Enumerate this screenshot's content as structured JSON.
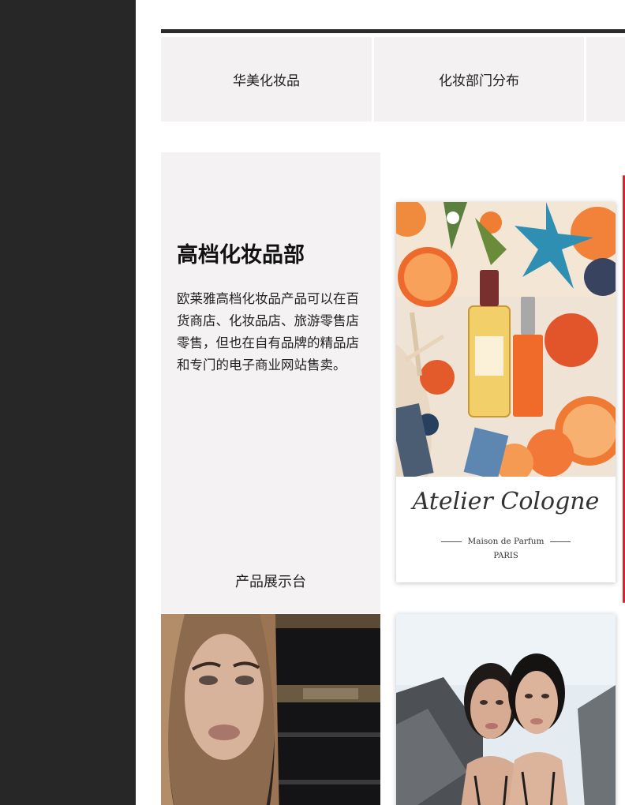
{
  "tabs": [
    {
      "label": "华美化妆品"
    },
    {
      "label": "化妆部门分布"
    },
    {
      "label": ""
    }
  ],
  "section": {
    "title": "高档化妆品部",
    "description": "欧莱雅高档化妆品产品可以在百货商店、化妆品店、旅游零售店零售，但也在自有品牌的精品店和专门的电子商业网站售卖。",
    "showcase_label": "产品展示台"
  },
  "cards": {
    "atelier": {
      "brand": "Atelier Cologne",
      "subtitle": "Maison de Parfum",
      "city": "PARIS"
    }
  },
  "colors": {
    "rail": "#272727",
    "panel": "#f4f2f3",
    "tab_bg": "#f3f1f2",
    "tab_border": "#2b2b2b",
    "accent_red": "#d8242a"
  }
}
